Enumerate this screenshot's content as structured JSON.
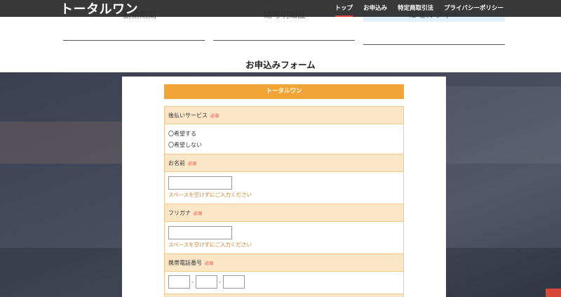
{
  "header": {
    "logo": "トータルワン",
    "nav": [
      {
        "label": "トップ",
        "active": true
      },
      {
        "label": "お申込み",
        "active": false
      },
      {
        "label": "特定商取引法",
        "active": false
      },
      {
        "label": "プライバシーポリシー",
        "active": false
      }
    ]
  },
  "peek": {
    "col1": "勤務期間",
    "col2": "給与明細証",
    "col3": "IDセルフィー"
  },
  "section": {
    "title": "お申込みフォーム"
  },
  "form": {
    "title": "トータルワン",
    "required_label": "必須",
    "fields": {
      "service": {
        "label": "後払いサービス",
        "options": [
          "〇希望する",
          "〇希望しない"
        ]
      },
      "name": {
        "label": "お名前",
        "value": "",
        "hint": "スペースを空けずにご入力ください"
      },
      "kana": {
        "label": "フリガナ",
        "value": "",
        "hint": "スペースを空けずにご入力ください"
      },
      "phone": {
        "label": "携帯電話番号",
        "separator": "-"
      }
    }
  },
  "colors": {
    "accent": "#f0a536",
    "label_bg": "#fbe6c7",
    "required": "#e0423a",
    "hint": "#d4822a",
    "header_bg": "#282828"
  }
}
